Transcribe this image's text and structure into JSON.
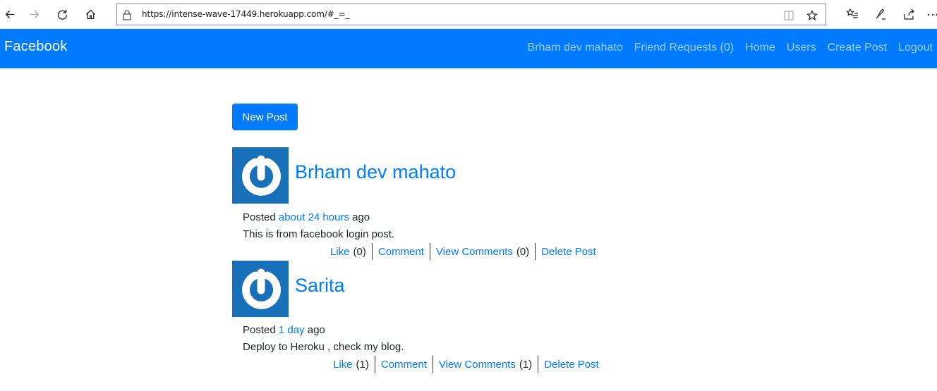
{
  "browser": {
    "url": "https://intense-wave-17449.herokuapp.com/#_=_",
    "icons": [
      "back-icon",
      "forward-icon",
      "refresh-icon",
      "home-icon",
      "lock-icon",
      "reading-view-icon",
      "favorite-star-icon",
      "favorites-list-icon",
      "pen-icon",
      "share-icon",
      "more-icon"
    ]
  },
  "navbar": {
    "brand": "Facebook",
    "links": [
      "Brham dev mahato",
      "Friend Requests (0)",
      "Home",
      "Users",
      "Create Post",
      "Logout"
    ],
    "color": "#007bff"
  },
  "main": {
    "new_post_label": "New Post",
    "posts": [
      {
        "author": "Brham dev mahato",
        "posted_prefix": "Posted",
        "time": "about 24 hours",
        "posted_suffix": "ago",
        "body": "This is from facebook login post.",
        "like_label": "Like",
        "like_count": "(0)",
        "comment_label": "Comment",
        "view_comments_label": "View Comments",
        "comments_count": "(0)",
        "delete_label": "Delete Post"
      },
      {
        "author": "Sarita",
        "posted_prefix": "Posted",
        "time": "1 day",
        "posted_suffix": "ago",
        "body": "Deploy to Heroku , check my blog.",
        "like_label": "Like",
        "like_count": "(1)",
        "comment_label": "Comment",
        "view_comments_label": "View Comments",
        "comments_count": "(1)",
        "delete_label": "Delete Post"
      }
    ]
  }
}
